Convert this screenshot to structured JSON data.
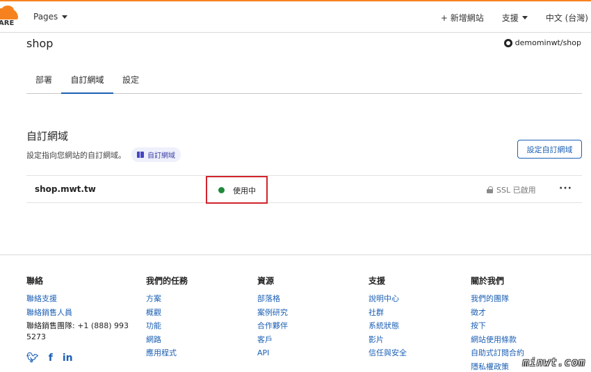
{
  "topnav": {
    "logo_text": "ARE",
    "pages_label": "Pages",
    "add_site": "+ 新增網站",
    "support": "支援",
    "language": "中文 (台灣)"
  },
  "header": {
    "project": "shop",
    "repo": "demominwt/shop"
  },
  "tabs": [
    "部署",
    "自訂網域",
    "設定"
  ],
  "section": {
    "title": "自訂網域",
    "description": "設定指向您網站的自訂網域。",
    "doc_pill": "自訂網域",
    "setup_button": "設定自訂網域"
  },
  "domain_row": {
    "domain": "shop.mwt.tw",
    "status": "使用中",
    "ssl": "SSL 已啟用",
    "more": "···"
  },
  "footer": {
    "contact": {
      "heading": "聯絡",
      "links": [
        "聯絡支援",
        "聯絡銷售人員"
      ],
      "phone": "聯絡銷售團隊: +1 (888) 993 5273"
    },
    "mission": {
      "heading": "我們的任務",
      "links": [
        "方案",
        "概觀",
        "功能",
        "網路",
        "應用程式"
      ]
    },
    "resources": {
      "heading": "資源",
      "links": [
        "部落格",
        "案例研究",
        "合作夥伴",
        "客戶",
        "API"
      ]
    },
    "support": {
      "heading": "支援",
      "links": [
        "說明中心",
        "社群",
        "系統狀態",
        "影片",
        "信任與安全"
      ]
    },
    "about": {
      "heading": "關於我們",
      "links": [
        "我們的團隊",
        "徵才",
        "按下",
        "網站使用條款",
        "自助式訂閱合約",
        "隱私權政策"
      ]
    }
  },
  "watermark": "minwt.com"
}
